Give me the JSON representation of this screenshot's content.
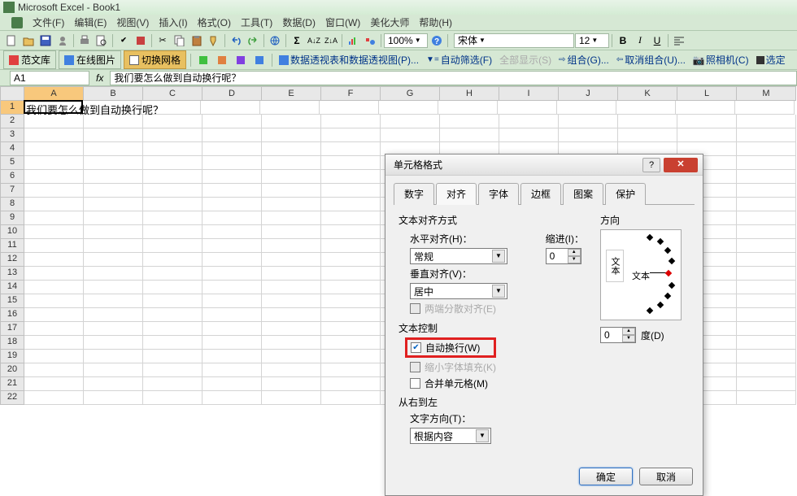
{
  "window": {
    "title": "Microsoft Excel - Book1"
  },
  "menu": {
    "file": "文件(F)",
    "edit": "编辑(E)",
    "view": "视图(V)",
    "insert": "插入(I)",
    "format": "格式(O)",
    "tools": "工具(T)",
    "data": "数据(D)",
    "window": "窗口(W)",
    "beautify": "美化大师",
    "help": "帮助(H)"
  },
  "toolbar1": {
    "zoom": "100%",
    "font": "宋体",
    "size": "12"
  },
  "toolbar2": {
    "fwk": "范文库",
    "zxtp": "在线图片",
    "qhwg": "切换网格",
    "pivot": "数据透视表和数据透视图(P)...",
    "autofilter": "自动筛选(F)",
    "showall": "全部显示(S)",
    "group": "组合(G)...",
    "ungroup": "取消组合(U)...",
    "camera": "照相机(C)",
    "select": "选定"
  },
  "namebox": "A1",
  "formula": "我们要怎么做到自动换行呢？",
  "columns": [
    "A",
    "B",
    "C",
    "D",
    "E",
    "F",
    "G",
    "H",
    "I",
    "J",
    "K",
    "L",
    "M"
  ],
  "cellA1": "我们要怎么做到自动换行呢？",
  "dialog": {
    "title": "单元格格式",
    "tabs": {
      "number": "数字",
      "align": "对齐",
      "font": "字体",
      "border": "边框",
      "pattern": "图案",
      "protect": "保护"
    },
    "groups": {
      "textAlign": "文本对齐方式",
      "hAlign": "水平对齐(H)：",
      "hAlignVal": "常规",
      "vAlign": "垂直对齐(V)：",
      "vAlignVal": "居中",
      "justifyDist": "两端分散对齐(E)",
      "indent": "缩进(I)：",
      "indentVal": "0",
      "textCtrl": "文本控制",
      "wrap": "自动换行(W)",
      "shrink": "缩小字体填充(K)",
      "merge": "合并单元格(M)",
      "rtl": "从右到左",
      "dir": "文字方向(T)：",
      "dirVal": "根据内容",
      "orient": "方向",
      "orientVText": "文本",
      "orientLabel": "文本",
      "degVal": "0",
      "degLabel": "度(D)"
    },
    "buttons": {
      "ok": "确定",
      "cancel": "取消"
    }
  }
}
